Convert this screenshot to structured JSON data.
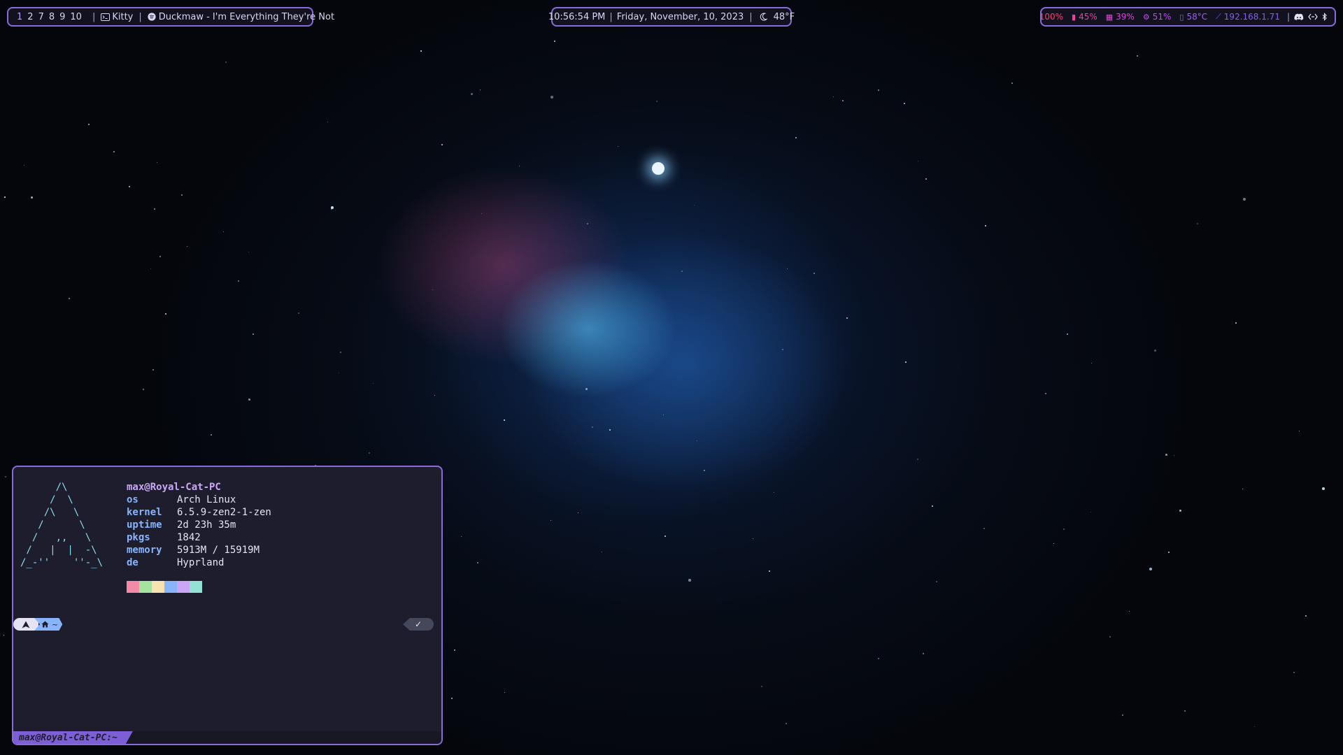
{
  "wallpaper": {
    "description_icon": "nebula-wallpaper"
  },
  "topbar": {
    "workspaces": [
      "1",
      "2",
      "7",
      "8",
      "9",
      "10"
    ],
    "active_workspace": "1",
    "window_app": "Kitty",
    "window_app_icon": "terminal-icon",
    "media_icon": "spotify-icon",
    "media_title": "Duckmaw - I'm Everything They're Not",
    "time": "10:56:54 PM",
    "date": "Friday, November, 10, 2023",
    "weather_icon": "moon-icon",
    "weather_temp": "48°F",
    "volume": "100%",
    "battery": "45%",
    "memory": "39%",
    "cpu": "51%",
    "temperature": "58°C",
    "ip": "192.168.1.71",
    "colors": {
      "accent_border": "#8b6bd9",
      "volume": "#ff3f6c",
      "battery": "#f03fa0",
      "memory": "#e045d8",
      "cpu": "#c04bf0",
      "temperature": "#a25cf7",
      "ip": "#8a5cf0"
    }
  },
  "terminal": {
    "ascii_logo": "      /\\\n     /  \\\n    /\\   \\\n   /      \\\n  /   ,,   \\\n /   |  |  -\\\n/_-''    ''-_\\",
    "host": "max@Royal-Cat-PC",
    "info": [
      {
        "key": "os",
        "value": "Arch Linux"
      },
      {
        "key": "kernel",
        "value": "6.5.9-zen2-1-zen"
      },
      {
        "key": "uptime",
        "value": "2d 23h 35m"
      },
      {
        "key": "pkgs",
        "value": "1842"
      },
      {
        "key": "memory",
        "value": "5913M / 15919M"
      },
      {
        "key": "de",
        "value": "Hyprland"
      }
    ],
    "palette": [
      "#f38ba8",
      "#a6e3a1",
      "#f9e2af",
      "#89b4fa",
      "#cba6f7",
      "#94e2d5"
    ],
    "prompt_path": "~",
    "prompt_status": "✓",
    "status_tab": "max@Royal-Cat-PC:~"
  }
}
